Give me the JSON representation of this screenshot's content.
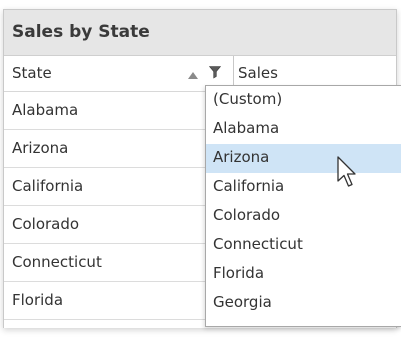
{
  "panel": {
    "title": "Sales by State",
    "columns": {
      "state": "State",
      "sales": "Sales"
    },
    "rows": [
      "Alabama",
      "Arizona",
      "California",
      "Colorado",
      "Connecticut",
      "Florida"
    ]
  },
  "filter_dropdown": {
    "options": [
      "(Custom)",
      "Alabama",
      "Arizona",
      "California",
      "Colorado",
      "Connecticut",
      "Florida",
      "Georgia"
    ],
    "highlighted": "Arizona"
  },
  "icons": {
    "sort": "sort-ascending-icon",
    "filter": "filter-funnel-icon",
    "cursor": "mouse-pointer-icon"
  },
  "colors": {
    "title_bg": "#e6e6e6",
    "highlight": "#cfe4f6"
  }
}
